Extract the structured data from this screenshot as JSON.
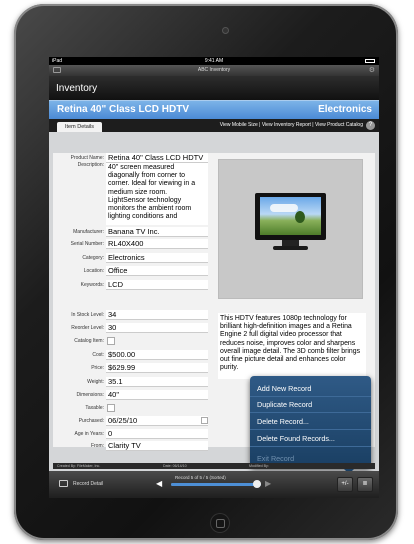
{
  "status_bar": {
    "carrier": "iPad",
    "time": "9:41 AM"
  },
  "app_title": "ABC Inventory",
  "page_header": "Inventory",
  "record": {
    "title": "Retina 40\" Class LCD HDTV",
    "category": "Electronics"
  },
  "tabs": {
    "active": "Item Details"
  },
  "links": {
    "text": "View Mobile Size | View Inventory Report | View Product Catalog",
    "help": "?"
  },
  "labels": {
    "product_name": "Product Name:",
    "description": "Description:",
    "manufacturer": "Manufacturer:",
    "serial_number": "Serial Number:",
    "category": "Category:",
    "location": "Location:",
    "keywords": "Keywords:",
    "in_stock": "In Stock Level:",
    "reorder": "Reorder Level:",
    "catalog_item": "Catalog Item:",
    "cost": "Cost:",
    "price": "Price:",
    "weight": "Weight:",
    "dimensions": "Dimensions:",
    "taxable": "Taxable:",
    "purchased": "Purchased:",
    "age": "Age in Years:",
    "from": "From:"
  },
  "fields": {
    "product_name": "Retina 40\" Class LCD HDTV",
    "description": "40\" screen measured diagonally from corner to corner.  Ideal for viewing in a medium size room. LightSensor technology monitors the ambient room lighting conditions and",
    "manufacturer": "Banana TV Inc.",
    "serial_number": "RL40X400",
    "category": "Electronics",
    "location": "Office",
    "keywords": "LCD",
    "in_stock": "34",
    "reorder": "30",
    "cost": "$500.00",
    "price": "$629.99",
    "weight": "35.1",
    "dimensions": "40\"",
    "purchased": "06/25/10",
    "age": "0",
    "from": "Clarity TV"
  },
  "long_description": "This HDTV features 1080p technology for brilliant high-definition images and a Retina Engine 2 full digital video processor that reduces noise, improves color and sharpens overall image detail. The 3D comb filter brings out fine picture detail and enhances color purity.",
  "popup_menu": {
    "items": [
      "Add New Record",
      "Duplicate Record",
      "Delete Record...",
      "Delete Found Records...",
      "Exit Record"
    ]
  },
  "footer_info": {
    "created_by": "Created By:  FileMaker, Inc.",
    "date": "Date:  06/14/10",
    "modified_by": "Modified By:"
  },
  "bottom_bar": {
    "record_label": "Record Detail",
    "record_status": "Record 5 of 5 / 5 (Sorted)",
    "progress_fraction": 1.0
  },
  "colors": {
    "accent_blue": "#4b8ad6",
    "popup_blue": "#1f4b75"
  }
}
